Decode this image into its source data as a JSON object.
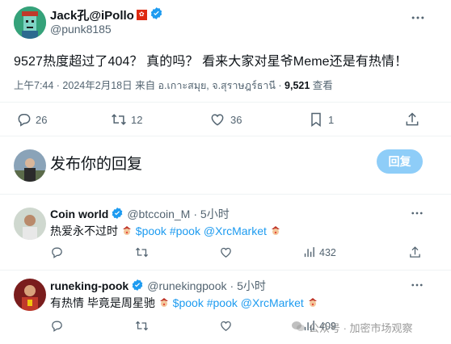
{
  "main_post": {
    "display_name": "Jack孔@iPollo",
    "handle": "@punk8185",
    "text": "9527热度超过了404？ 真的吗？ 看来大家对星爷Meme还是有热情！",
    "meta_time_date": "上午7:44 · 2024年2月18日 来自 อ.เกาะสมุย, จ.สุราษฎร์ธานี · ",
    "views_count": "9,521",
    "views_label": " 查看",
    "actions": {
      "replies": "26",
      "reposts": "12",
      "likes": "36",
      "bookmarks": "1"
    }
  },
  "compose": {
    "placeholder": "发布你的回复",
    "reply_button": "回复"
  },
  "replies": [
    {
      "display_name": "Coin world",
      "handle": "@btccoin_M",
      "time": "· 5小时",
      "text_prefix": "热爱永不过时",
      "cashtag": "$pook",
      "hashtag": "#pook",
      "mention": "@XrcMarket",
      "views": "432"
    },
    {
      "display_name": "runeking-pook",
      "handle": "@runekingpook",
      "time": "· 5小时",
      "text_prefix": "有热情 毕竟是周星驰",
      "cashtag": "$pook",
      "hashtag": "#pook",
      "mention": "@XrcMarket",
      "views": "409"
    }
  ],
  "watermark": "公众号 · 加密市场观察",
  "colors": {
    "accent": "#1d9bf0",
    "reply_button_disabled": "#8ecdf8",
    "muted": "#536471",
    "divider": "#eff3f4"
  }
}
